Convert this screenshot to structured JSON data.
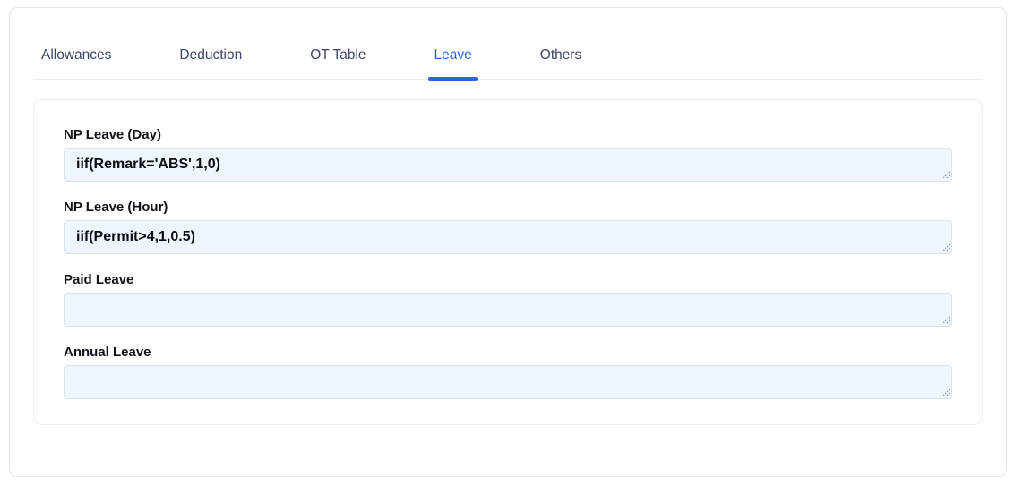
{
  "tabs": [
    {
      "label": "Allowances",
      "active": false
    },
    {
      "label": "Deduction",
      "active": false
    },
    {
      "label": "OT Table",
      "active": false
    },
    {
      "label": "Leave",
      "active": true
    },
    {
      "label": "Others",
      "active": false
    }
  ],
  "fields": [
    {
      "label": "NP Leave (Day)",
      "value": "iif(Remark='ABS',1,0)"
    },
    {
      "label": "NP Leave (Hour)",
      "value": "iif(Permit>4,1,0.5)"
    },
    {
      "label": "Paid Leave",
      "value": ""
    },
    {
      "label": "Annual Leave",
      "value": ""
    }
  ],
  "icons": {
    "resize_grip": "diagonal-lines"
  },
  "colors": {
    "active_tab": "#2e63e2",
    "inactive_tab_text": "#3d4468",
    "textarea_background": "#eef5fd",
    "textarea_border": "#d9e3f0",
    "panel_border": "#e8edf4",
    "outer_border": "#dfe3ee"
  }
}
